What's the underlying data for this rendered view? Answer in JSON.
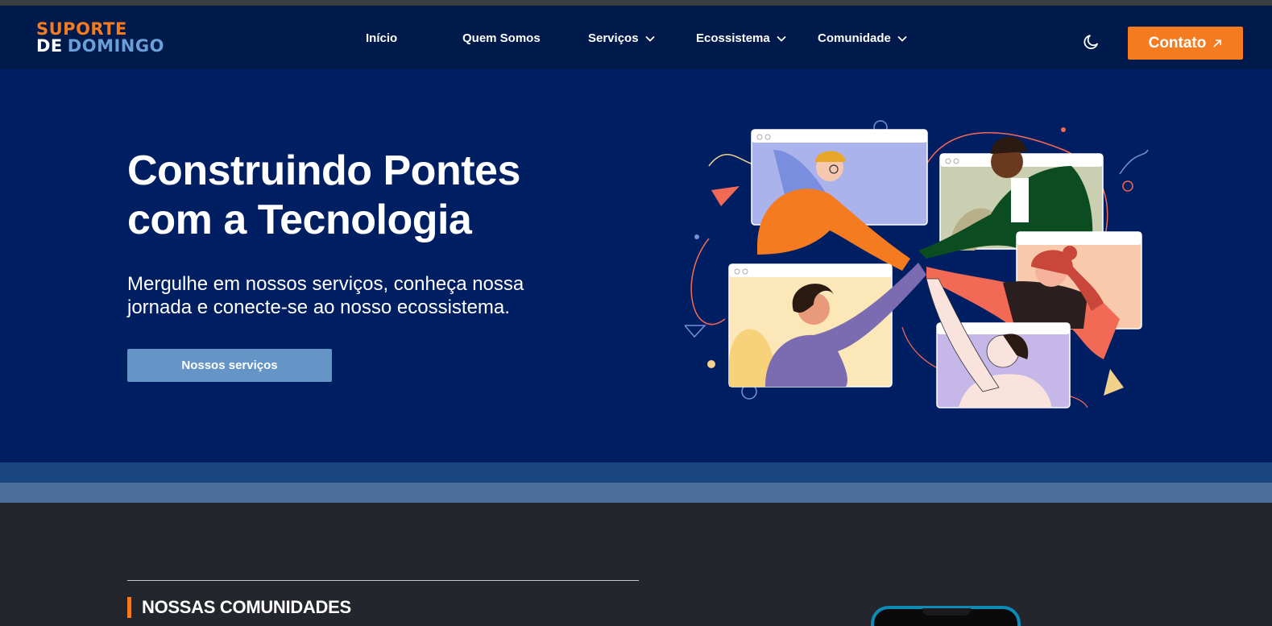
{
  "brand": {
    "line1": "SUPORTE",
    "line2_a": "DE",
    "line2_b": "DOMINGO"
  },
  "nav": {
    "items": [
      {
        "label": "Início",
        "has_dropdown": false
      },
      {
        "label": "Quem Somos",
        "has_dropdown": false
      },
      {
        "label": "Serviços",
        "has_dropdown": true
      },
      {
        "label": "Ecossistema",
        "has_dropdown": true
      },
      {
        "label": "Comunidade",
        "has_dropdown": true
      }
    ],
    "theme_toggle_icon": "moon-icon",
    "contact_label": "Contato",
    "contact_icon": "arrow-up-right-icon"
  },
  "hero": {
    "title_line1": "Construindo Pontes",
    "title_line2": "com a Tecnologia",
    "subtitle": "Mergulhe em nossos serviços, conheça nossa jornada e conecte-se ao nosso ecossistema.",
    "cta_label": "Nossos serviços",
    "illustration_icon": "people-high-five-video-call-illustration"
  },
  "section": {
    "title": "NOSSAS COMUNIDADES"
  },
  "colors": {
    "nav_bg": "#001a4b",
    "hero_bg": "#001f63",
    "accent_orange": "#f47b20",
    "cta_blue": "#6594c6",
    "band_dark": "#1a4680",
    "band_light": "#4d6d9a",
    "page_dark": "#23262c"
  }
}
